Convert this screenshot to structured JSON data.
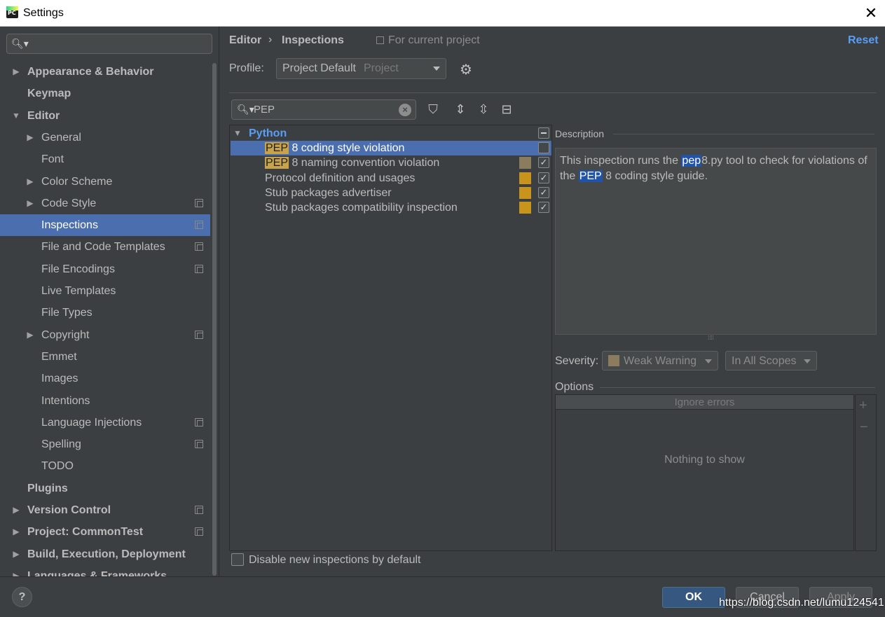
{
  "window": {
    "title": "Settings",
    "close_glyph": "✕"
  },
  "sidebar": {
    "search_placeholder": "",
    "items": [
      {
        "label": "Appearance & Behavior",
        "level": 0,
        "arrow": "▶",
        "bold": true
      },
      {
        "label": "Keymap",
        "level": 0,
        "arrow": "",
        "bold": true
      },
      {
        "label": "Editor",
        "level": 0,
        "arrow": "▼",
        "bold": true
      },
      {
        "label": "General",
        "level": 1,
        "arrow": "▶"
      },
      {
        "label": "Font",
        "level": 1,
        "arrow": ""
      },
      {
        "label": "Color Scheme",
        "level": 1,
        "arrow": "▶"
      },
      {
        "label": "Code Style",
        "level": 1,
        "arrow": "▶",
        "project_icon": true
      },
      {
        "label": "Inspections",
        "level": 1,
        "arrow": "",
        "project_icon": true,
        "selected": true
      },
      {
        "label": "File and Code Templates",
        "level": 1,
        "arrow": "",
        "project_icon": true
      },
      {
        "label": "File Encodings",
        "level": 1,
        "arrow": "",
        "project_icon": true
      },
      {
        "label": "Live Templates",
        "level": 1,
        "arrow": ""
      },
      {
        "label": "File Types",
        "level": 1,
        "arrow": ""
      },
      {
        "label": "Copyright",
        "level": 1,
        "arrow": "▶",
        "project_icon": true
      },
      {
        "label": "Emmet",
        "level": 1,
        "arrow": ""
      },
      {
        "label": "Images",
        "level": 1,
        "arrow": ""
      },
      {
        "label": "Intentions",
        "level": 1,
        "arrow": ""
      },
      {
        "label": "Language Injections",
        "level": 1,
        "arrow": "",
        "project_icon": true
      },
      {
        "label": "Spelling",
        "level": 1,
        "arrow": "",
        "project_icon": true
      },
      {
        "label": "TODO",
        "level": 1,
        "arrow": ""
      },
      {
        "label": "Plugins",
        "level": 0,
        "arrow": "",
        "bold": true
      },
      {
        "label": "Version Control",
        "level": 0,
        "arrow": "▶",
        "bold": true,
        "project_icon": true
      },
      {
        "label": "Project: CommonTest",
        "level": 0,
        "arrow": "▶",
        "bold": true,
        "project_icon": true
      },
      {
        "label": "Build, Execution, Deployment",
        "level": 0,
        "arrow": "▶",
        "bold": true
      },
      {
        "label": "Languages & Frameworks",
        "level": 0,
        "arrow": "▶",
        "bold": true
      }
    ]
  },
  "header": {
    "breadcrumb_editor": "Editor",
    "breadcrumb_sep": "›",
    "breadcrumb_inspections": "Inspections",
    "for_current_project": "For current project",
    "reset": "Reset"
  },
  "profile": {
    "label": "Profile:",
    "value": "Project Default",
    "scope": "Project"
  },
  "filter": {
    "value": "PEP"
  },
  "inspections": {
    "group": "Python",
    "items": [
      {
        "highlight": "PEP",
        "rest": " 8 coding style violation",
        "selected": true,
        "checked": false,
        "severity_color": ""
      },
      {
        "highlight": "PEP",
        "rest": " 8 naming convention violation",
        "checked": true,
        "severity_color": "#8b7c60"
      },
      {
        "highlight": "",
        "rest": "Protocol definition and usages",
        "checked": true,
        "severity_color": "#c8941c"
      },
      {
        "highlight": "",
        "rest": "Stub packages advertiser",
        "checked": true,
        "severity_color": "#c8941c"
      },
      {
        "highlight": "",
        "rest": "Stub packages compatibility inspection",
        "checked": true,
        "severity_color": "#c8941c"
      }
    ]
  },
  "description": {
    "label": "Description",
    "part1": "This inspection runs the ",
    "hl1": "pep",
    "part2": "8.py tool to check for violations of the ",
    "hl2": "PEP",
    "part3": " 8 coding style guide."
  },
  "severity": {
    "label": "Severity:",
    "value": "Weak Warning",
    "color": "#8b7c60",
    "scope": "In All Scopes"
  },
  "options": {
    "label": "Options",
    "column": "Ignore errors",
    "empty": "Nothing to show",
    "add": "+",
    "remove": "−"
  },
  "footer": {
    "disable_label": "Disable new inspections by default",
    "help": "?",
    "ok": "OK",
    "cancel": "Cancel",
    "apply": "Apply",
    "watermark": "https://blog.csdn.net/lumu124541"
  },
  "colors": {
    "accent": "#589df6",
    "selection": "#4b6eaf",
    "weak_warning": "#8b7c60",
    "warning": "#c8941c"
  }
}
